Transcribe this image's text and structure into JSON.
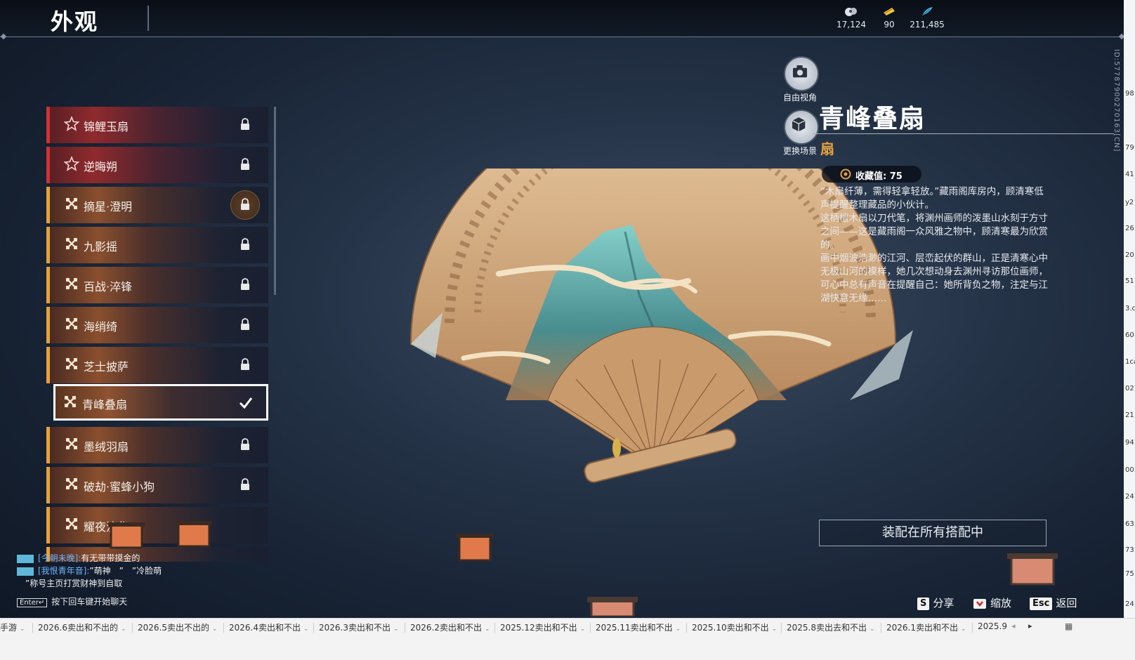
{
  "header": {
    "title": "外观",
    "currencies": [
      {
        "icon": "cloud-token-icon",
        "value": "17,124"
      },
      {
        "icon": "ticket-icon",
        "value": "90"
      },
      {
        "icon": "feather-coin-icon",
        "value": "211,485"
      }
    ]
  },
  "items": [
    {
      "name": "锦鲤玉扇",
      "rarity": "red",
      "state": "locked"
    },
    {
      "name": "逆晦朔",
      "rarity": "red",
      "state": "locked"
    },
    {
      "name": "摘星·澄明",
      "rarity": "gold",
      "state": "locked-ring"
    },
    {
      "name": "九影摇",
      "rarity": "gold",
      "state": "locked"
    },
    {
      "name": "百战·淬锋",
      "rarity": "gold",
      "state": "locked"
    },
    {
      "name": "海绡绮",
      "rarity": "gold",
      "state": "locked"
    },
    {
      "name": "芝士披萨",
      "rarity": "gold",
      "state": "locked"
    },
    {
      "name": "青峰叠扇",
      "rarity": "gold",
      "state": "selected"
    },
    {
      "name": "墨绒羽扇",
      "rarity": "gold",
      "state": "locked"
    },
    {
      "name": "破劫·蜜蜂小狗",
      "rarity": "gold",
      "state": "locked"
    },
    {
      "name": "耀夜流华",
      "rarity": "gold",
      "state": "none"
    }
  ],
  "camera": {
    "free_view": "自由视角",
    "change_scene": "更换场景"
  },
  "detail": {
    "title": "青峰叠扇",
    "type": "扇",
    "collect_label": "收藏值: 75",
    "description": [
      "“木扇纤薄，需得轻拿轻放。”藏雨阁库房内，顾清寒低声提醒整理藏品的小伙计。",
      "这柄檀木扇以刀代笔，将渊州画师的泼墨山水刻于方寸之间——这是藏雨阁一众风雅之物中，顾清寒最为欣赏的。",
      "画中烟波浩渺的江河、层峦起伏的群山，正是清寒心中无极山河的模样，她几次想动身去渊州寻访那位画师，可心中总有声音在提醒自己：她所背负之物，注定与江湖快意无缘……"
    ],
    "equip_button": "装配在所有搭配中"
  },
  "hints": [
    {
      "key": "S",
      "label": "分享"
    },
    {
      "key": "zoom-icon",
      "label": "缩放"
    },
    {
      "key": "Esc",
      "label": "返回"
    }
  ],
  "chat": {
    "lines": [
      {
        "name": "[今朝未晚]:",
        "text": "有无带带摸金的"
      },
      {
        "name": "[我恨青年音]:",
        "text": "”萌神　”　”冷脸萌"
      },
      {
        "name": "",
        "text": "”称号主页打赏财神到自取"
      }
    ],
    "enter_key": "Enter↵",
    "enter_hint": "按下回车键开始聊天"
  },
  "id_text": "ID:5778790027016​3[CN]",
  "edge_numbers": [
    "98",
    "79",
    "41",
    "y2",
    "26",
    "20",
    "51",
    "3.c",
    "60",
    "1ca",
    "02",
    "21",
    "94",
    "00",
    "24",
    "63",
    "73",
    "75",
    "24"
  ],
  "tabs": [
    "手游",
    "2026.6卖出和不出的",
    "2026.5卖出不出的",
    "2026.4卖出和不出",
    "2026.3卖出和不出",
    "2026.2卖出和不出",
    "2025.12卖出和不出",
    "2025.11卖出和不出",
    "2025.10卖出和不出",
    "2025.8卖出去和不出",
    "2026.1卖出和不出",
    "2025.9"
  ]
}
